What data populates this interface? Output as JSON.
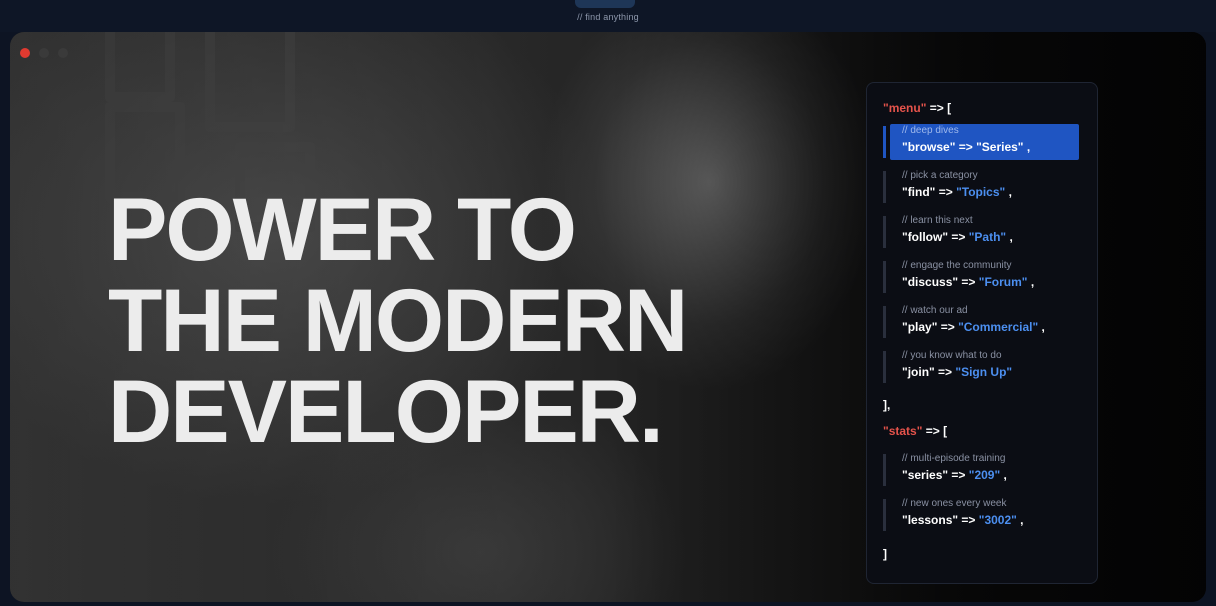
{
  "topbar": {
    "hint": "// find anything"
  },
  "hero": {
    "headline_lines": [
      "POWER TO",
      "THE MODERN",
      "DEVELOPER."
    ]
  },
  "menu": {
    "key": "\"menu\"",
    "open": " => [",
    "items": [
      {
        "comment": "// deep dives",
        "key": "\"browse\"",
        "arrow": " => ",
        "value": "\"Series\"",
        "trail": " ,",
        "active": true
      },
      {
        "comment": "// pick a category",
        "key": "\"find\"",
        "arrow": " => ",
        "value": "\"Topics\"",
        "trail": " ,"
      },
      {
        "comment": "// learn this next",
        "key": "\"follow\"",
        "arrow": " => ",
        "value": "\"Path\"",
        "trail": " ,"
      },
      {
        "comment": "// engage the community",
        "key": "\"discuss\"",
        "arrow": " => ",
        "value": "\"Forum\"",
        "trail": " ,"
      },
      {
        "comment": "// watch our ad",
        "key": "\"play\"",
        "arrow": " => ",
        "value": "\"Commercial\"",
        "trail": " ,"
      },
      {
        "comment": "// you know what to do",
        "key": "\"join\"",
        "arrow": " => ",
        "value": "\"Sign Up\"",
        "trail": ""
      }
    ],
    "close": "],"
  },
  "stats": {
    "key": "\"stats\"",
    "open": " => [",
    "items": [
      {
        "comment": "// multi-episode training",
        "key": "\"series\"",
        "arrow": " => ",
        "value": "\"209\"",
        "trail": " ,"
      },
      {
        "comment": "// new ones every week",
        "key": "\"lessons\"",
        "arrow": " => ",
        "value": "\"3002\"",
        "trail": " ,"
      }
    ],
    "close": "]"
  },
  "colors": {
    "accent": "#1f55c2",
    "key_red": "#e5534b",
    "value_blue": "#4c8ff0"
  }
}
